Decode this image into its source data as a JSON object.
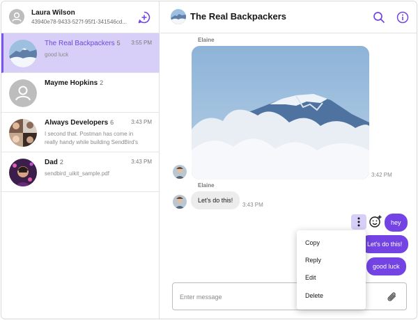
{
  "colors": {
    "accent": "#7443e4",
    "accent_light": "#d8cff8",
    "active_text": "#6e47d9"
  },
  "user": {
    "name": "Laura Wilson",
    "id": "43940e78-9433-527f-95f1-341546cd..."
  },
  "channels": [
    {
      "title": "The Real Backpackers",
      "count": "5",
      "time": "3:55 PM",
      "last_message": "good luck",
      "avatar": "mountain-photo"
    },
    {
      "title": "Mayme Hopkins",
      "count": "2",
      "time": "",
      "last_message": "",
      "avatar": "default-person-icon"
    },
    {
      "title": "Always Developers",
      "count": "6",
      "time": "3:43 PM",
      "last_message": "I second that. Postman has come in really handy while building SendBird's",
      "avatar": "group-photo"
    },
    {
      "title": "Dad",
      "count": "2",
      "time": "3:43 PM",
      "last_message": "sendbird_uikit_sample.pdf",
      "avatar": "person-photo"
    }
  ],
  "conversation": {
    "title": "The Real Backpackers",
    "messages": [
      {
        "sender": "Elaine",
        "type": "image",
        "time": "3:42 PM"
      },
      {
        "sender": "Elaine",
        "type": "text",
        "text": "Let's do this!",
        "time": "3:43 PM"
      },
      {
        "type": "outgoing",
        "text": "hey"
      },
      {
        "type": "outgoing",
        "text": "Let's do this!"
      },
      {
        "type": "outgoing",
        "text": "good luck"
      }
    ]
  },
  "context_menu": {
    "items": [
      "Copy",
      "Reply",
      "Edit",
      "Delete"
    ]
  },
  "input": {
    "placeholder": "Enter message"
  },
  "icons": {
    "new_chat": "chat-plus-icon",
    "search": "search-icon",
    "info": "info-icon",
    "more": "more-vertical-icon",
    "reaction": "add-reaction-icon",
    "attach": "paperclip-icon"
  }
}
